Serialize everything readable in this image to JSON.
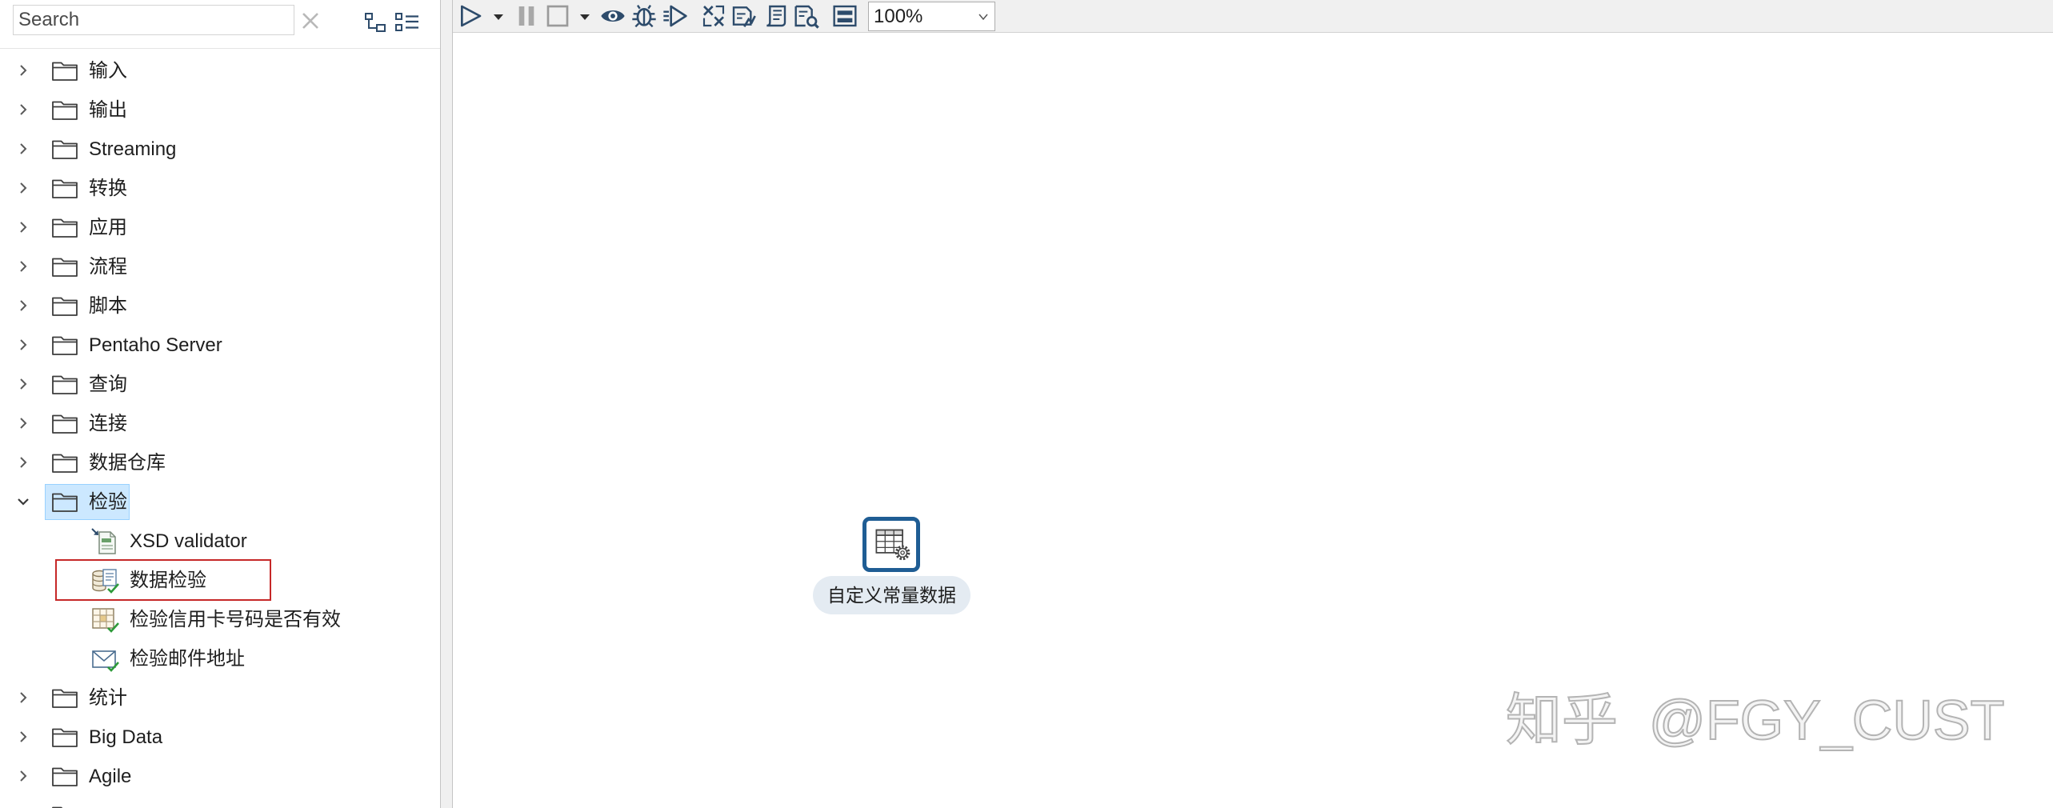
{
  "search": {
    "placeholder": "Search",
    "value": ""
  },
  "panel": {
    "icons": {
      "clear": "close-icon",
      "expand_all": "expand-all-icon",
      "collapse_all": "collapse-all-icon"
    }
  },
  "tree": {
    "items": [
      {
        "label": "输入",
        "icon": "folder-icon",
        "expanded": false
      },
      {
        "label": "输出",
        "icon": "folder-icon",
        "expanded": false
      },
      {
        "label": "Streaming",
        "icon": "folder-icon",
        "expanded": false
      },
      {
        "label": "转换",
        "icon": "folder-icon",
        "expanded": false
      },
      {
        "label": "应用",
        "icon": "folder-icon",
        "expanded": false
      },
      {
        "label": "流程",
        "icon": "folder-icon",
        "expanded": false
      },
      {
        "label": "脚本",
        "icon": "folder-icon",
        "expanded": false
      },
      {
        "label": "Pentaho Server",
        "icon": "folder-icon",
        "expanded": false
      },
      {
        "label": "查询",
        "icon": "folder-icon",
        "expanded": false
      },
      {
        "label": "连接",
        "icon": "folder-icon",
        "expanded": false
      },
      {
        "label": "数据仓库",
        "icon": "folder-icon",
        "expanded": false
      },
      {
        "label": "检验",
        "icon": "folder-icon",
        "expanded": true,
        "selected": true,
        "children": [
          {
            "label": "XSD validator",
            "icon": "xsd-validator-icon"
          },
          {
            "label": "数据检验",
            "icon": "data-validator-icon",
            "highlighted": true
          },
          {
            "label": "检验信用卡号码是否有效",
            "icon": "credit-card-validator-icon"
          },
          {
            "label": "检验邮件地址",
            "icon": "mail-validator-icon"
          }
        ]
      },
      {
        "label": "统计",
        "icon": "folder-icon",
        "expanded": false
      },
      {
        "label": "Big Data",
        "icon": "folder-icon",
        "expanded": false
      },
      {
        "label": "Agile",
        "icon": "folder-icon",
        "expanded": false
      }
    ]
  },
  "toolbar": {
    "buttons": [
      {
        "icon": "run-icon",
        "enabled": true
      },
      {
        "icon": "run-options-dropdown-icon",
        "enabled": true
      },
      {
        "icon": "pause-icon",
        "enabled": false
      },
      {
        "icon": "stop-icon",
        "enabled": false
      },
      {
        "icon": "stop-options-dropdown-icon",
        "enabled": true
      },
      {
        "icon": "preview-icon",
        "enabled": true
      },
      {
        "icon": "debug-icon",
        "enabled": true
      },
      {
        "icon": "replay-icon",
        "enabled": true
      },
      {
        "icon": "verify-icon",
        "enabled": true
      },
      {
        "icon": "impact-icon",
        "enabled": true
      },
      {
        "icon": "sql-icon",
        "enabled": true
      },
      {
        "icon": "explore-db-icon",
        "enabled": true
      },
      {
        "icon": "show-results-icon",
        "enabled": true
      }
    ],
    "zoom": {
      "value": "100%"
    }
  },
  "canvas": {
    "steps": [
      {
        "label": "自定义常量数据",
        "icon": "data-grid-step-icon"
      }
    ]
  },
  "watermark": {
    "text": "知乎  @FGY_CUST"
  },
  "colors": {
    "step_border": "#1f5d94",
    "selection_bg": "#cce8ff",
    "selection_border": "#99d1ff",
    "highlight_box": "#c62828",
    "toolbar_bg": "#f0f0f0",
    "step_label_bg": "#e4ebf2"
  }
}
